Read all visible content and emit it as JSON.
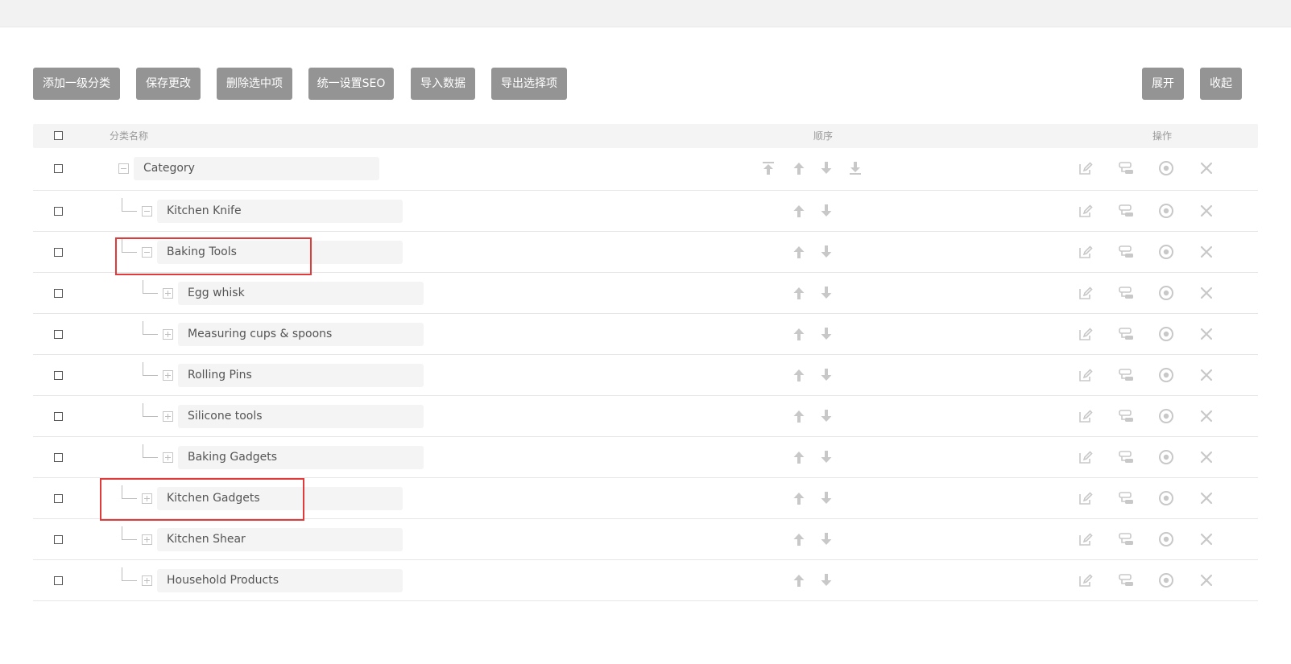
{
  "toolbar": {
    "add_top_category": "添加一级分类",
    "save_changes": "保存更改",
    "delete_selected": "删除选中项",
    "set_seo": "统一设置SEO",
    "import_data": "导入数据",
    "export_selected": "导出选择项",
    "expand": "展开",
    "collapse": "收起"
  },
  "table": {
    "headers": {
      "name": "分类名称",
      "order": "顺序",
      "actions": "操作"
    },
    "rows": [
      {
        "name": "Category",
        "level": 0,
        "toggle": "minus"
      },
      {
        "name": "Kitchen Knife",
        "level": 1,
        "toggle": "minus"
      },
      {
        "name": "Baking Tools",
        "level": 1,
        "toggle": "minus"
      },
      {
        "name": "Egg whisk",
        "level": 2,
        "toggle": "plus"
      },
      {
        "name": "Measuring cups & spoons",
        "level": 2,
        "toggle": "plus"
      },
      {
        "name": "Rolling Pins",
        "level": 2,
        "toggle": "plus"
      },
      {
        "name": "Silicone tools",
        "level": 2,
        "toggle": "plus"
      },
      {
        "name": "Baking Gadgets",
        "level": 2,
        "toggle": "plus"
      },
      {
        "name": "Kitchen Gadgets",
        "level": 1,
        "toggle": "plus"
      },
      {
        "name": "Kitchen Shear",
        "level": 1,
        "toggle": "plus"
      },
      {
        "name": "Household Products",
        "level": 1,
        "toggle": "plus"
      }
    ]
  },
  "icons": {
    "order_first_row": [
      "move-top-icon",
      "move-up-icon",
      "move-down-icon",
      "move-bottom-icon"
    ],
    "order_other_rows": [
      "move-up-icon",
      "move-down-icon"
    ],
    "actions": [
      "edit-icon",
      "seo-settings-icon",
      "view-icon",
      "delete-icon"
    ]
  },
  "colors": {
    "button_bg": "#949494",
    "header_bg": "#f4f4f4",
    "input_bg": "#f4f4f4",
    "icon": "#c8c8c8",
    "highlight": "#e03a3a"
  },
  "highlighted_rows": [
    "Baking Tools",
    "Kitchen Gadgets"
  ]
}
